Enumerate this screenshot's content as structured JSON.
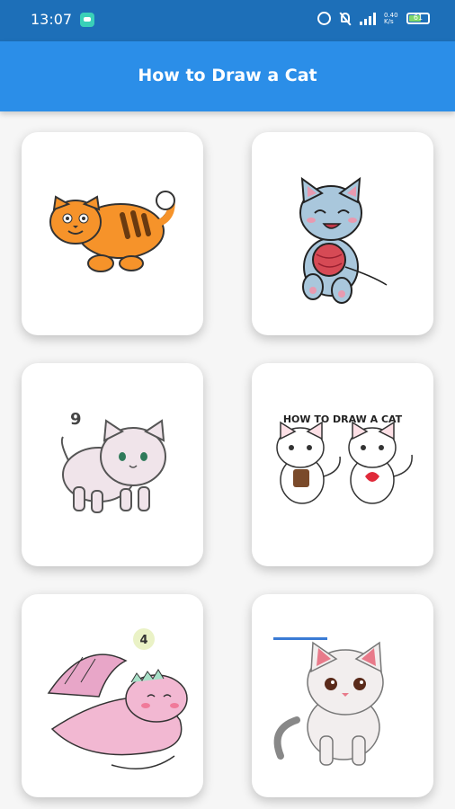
{
  "status_bar": {
    "time": "13:07",
    "network_rate": "0.40 K/s",
    "battery_level": "61",
    "icons": [
      "chat-notification-icon",
      "alarm-icon",
      "mute-icon",
      "signal-icon",
      "battery-icon"
    ]
  },
  "app_bar": {
    "title": "How to Draw a Cat"
  },
  "colors": {
    "app_bar": "#2b8ee8",
    "status_bar": "#1d6fb8",
    "background": "#f6f6f6"
  },
  "tutorials": [
    {
      "name": "orange-tabby-cat",
      "step_label": ""
    },
    {
      "name": "gray-kitten-with-yarn",
      "step_label": ""
    },
    {
      "name": "white-cat-step",
      "step_label": "9"
    },
    {
      "name": "two-kittens-tutorial",
      "step_label": "HOW TO DRAW A CAT"
    },
    {
      "name": "pink-dragon-cat",
      "step_label": "4"
    },
    {
      "name": "white-cat-sitting",
      "step_label": ""
    }
  ]
}
